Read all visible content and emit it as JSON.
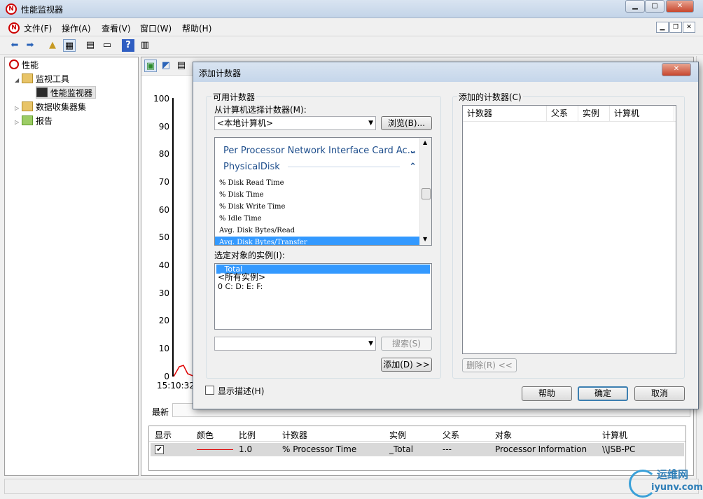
{
  "window": {
    "title": "性能监视器",
    "menu": [
      "文件(F)",
      "操作(A)",
      "查看(V)",
      "窗口(W)",
      "帮助(H)"
    ]
  },
  "tree": {
    "root": "性能",
    "items": [
      {
        "label": "监视工具",
        "level": 1,
        "expanded": true
      },
      {
        "label": "性能监视器",
        "level": 2,
        "selected": true
      },
      {
        "label": "数据收集器集",
        "level": 1,
        "expanded": false
      },
      {
        "label": "报告",
        "level": 1,
        "expanded": false
      }
    ]
  },
  "graph": {
    "y_ticks": [
      "100",
      "90",
      "80",
      "70",
      "60",
      "50",
      "40",
      "30",
      "20",
      "10",
      "0"
    ],
    "x_start": "15:10:32",
    "latest_label": "最新"
  },
  "counters_table": {
    "headers": [
      "显示",
      "颜色",
      "比例",
      "计数器",
      "实例",
      "父系",
      "对象",
      "计算机"
    ],
    "rows": [
      {
        "checked": true,
        "color": "#e00000",
        "scale": "1.0",
        "counter": "% Processor Time",
        "instance": "_Total",
        "parent": "---",
        "object": "Processor Information",
        "computer": "\\\\JSB-PC"
      }
    ]
  },
  "dialog": {
    "title": "添加计数器",
    "available_group": "可用计数器",
    "choose_computer_label": "从计算机选择计数器(M):",
    "computer_value": "<本地计算机>",
    "browse_button": "浏览(B)...",
    "objects": [
      {
        "label": "Per Processor Network Interface Card Ac...",
        "chevron": "⌄"
      },
      {
        "label": "PhysicalDisk",
        "chevron": "⌃"
      }
    ],
    "counters": [
      {
        "label": "% Disk Read Time",
        "selected": false
      },
      {
        "label": "% Disk Time",
        "selected": false
      },
      {
        "label": "% Disk Write Time",
        "selected": false
      },
      {
        "label": "% Idle Time",
        "selected": false
      },
      {
        "label": "Avg. Disk Bytes/Read",
        "selected": false
      },
      {
        "label": "Avg. Disk Bytes/Transfer",
        "selected": true
      }
    ],
    "instances_label": "选定对象的实例(I):",
    "instances": [
      {
        "label": "_Total",
        "selected": true
      },
      {
        "label": "<所有实例>",
        "selected": false
      },
      {
        "label": "0 C: D: E: F:",
        "selected": false
      }
    ],
    "search_value": "",
    "search_button": "搜索(S)",
    "add_button": "添加(D) >>",
    "added_group": "添加的计数器(C)",
    "added_headers": [
      "计数器",
      "父系",
      "实例",
      "计算机"
    ],
    "remove_button": "删除(R) <<",
    "show_desc_label": "显示描述(H)",
    "help_button": "帮助",
    "ok_button": "确定",
    "cancel_button": "取消"
  },
  "watermark": {
    "text_top": "运维网",
    "text_bottom": "iyunv.com"
  }
}
